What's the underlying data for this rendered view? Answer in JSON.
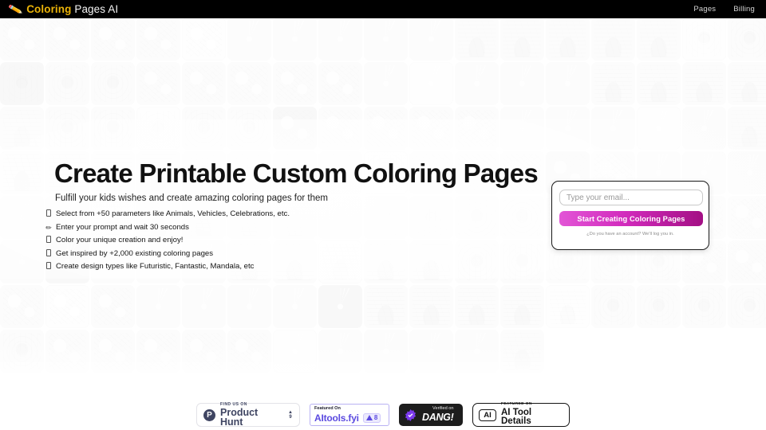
{
  "header": {
    "logo_icon": "pencil-icon",
    "logo_icon_glyph": "✏️",
    "brand_strong": "Coloring",
    "brand_light": " Pages AI",
    "nav": [
      {
        "label": "Pages"
      },
      {
        "label": "Billing"
      }
    ]
  },
  "hero": {
    "title": "Create Printable Custom Coloring Pages",
    "subtitle": "Fulfill your kids wishes and create amazing coloring pages for them",
    "bullets": [
      {
        "glyph": "tofu",
        "text": "Select from +50 parameters like Animals, Vehicles, Celebrations, etc."
      },
      {
        "glyph": "pencil",
        "text": "Enter your prompt and wait 30 seconds"
      },
      {
        "glyph": "tofu",
        "text": "Color your unique creation and enjoy!"
      },
      {
        "glyph": "tofu",
        "text": "Get inspired by +2,000 existing coloring pages"
      },
      {
        "glyph": "tofu",
        "text": "Create design types like Futuristic, Fantastic, Mandala, etc"
      }
    ]
  },
  "signup": {
    "email_placeholder": "Type your email...",
    "email_value": "",
    "cta_label": "Start Creating Coloring Pages",
    "note": "¿Do you have an account? We'll log you in.",
    "cta_gradient_from": "#e255d6",
    "cta_gradient_to": "#a30f84"
  },
  "footer": {
    "badges": [
      {
        "name": "product-hunt",
        "icon": "P",
        "small": "FIND US ON",
        "big": "Product Hunt",
        "vote_arrow": "▲",
        "vote_count": "9",
        "accent": "#3f4562"
      },
      {
        "name": "aitools-fyi",
        "small": "Featured On",
        "big": "AItools.fyi",
        "chip_count": "8",
        "accent": "#5b4ae0"
      },
      {
        "name": "dang",
        "small": "Verified on",
        "big": "DANG!",
        "accent": "#7c3aed"
      },
      {
        "name": "ai-tool-details",
        "icon": "AI",
        "small": "FEATURED ON",
        "big": "AI Tool Details",
        "accent": "#141414"
      }
    ]
  },
  "background": {
    "description": "faded grid of coloring page thumbnails",
    "tile_count": 131,
    "columns": 17
  }
}
